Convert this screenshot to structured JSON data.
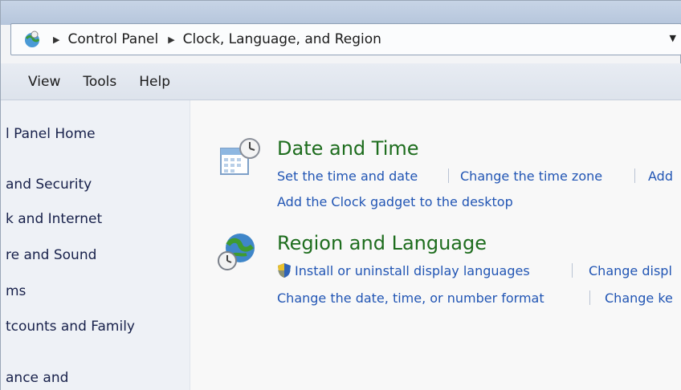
{
  "address_bar": {
    "crumbs": [
      "Control Panel",
      "Clock, Language, and Region"
    ]
  },
  "menu": {
    "items": [
      "View",
      "Tools",
      "Help"
    ]
  },
  "left_nav": {
    "items": [
      "l Panel Home",
      " and Security",
      "k and Internet",
      "re and Sound",
      "ms",
      "tcounts and Family",
      "ance and"
    ]
  },
  "categories": [
    {
      "title": "Date and Time",
      "links_row1": [
        "Set the time and date",
        "Change the time zone",
        "Add"
      ],
      "links_row2": [
        "Add the Clock gadget to the desktop"
      ]
    },
    {
      "title": "Region and Language",
      "links_row1": [
        "Install or uninstall display languages",
        "Change displ"
      ],
      "links_row2": [
        "Change the date, time, or number format",
        "Change ke"
      ]
    }
  ],
  "icons": {
    "address": "control-panel-globe-icon",
    "date_time": "calendar-clock-icon",
    "region": "globe-clock-icon",
    "uac": "uac-shield-icon"
  }
}
